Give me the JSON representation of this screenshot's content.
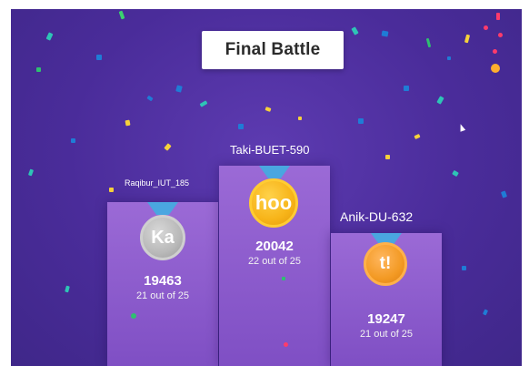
{
  "screen": {
    "title": "Final Battle",
    "background": "#4a2c9a"
  },
  "leaderboard": {
    "first": {
      "name": "Taki-BUET-590",
      "avatar": "hoo",
      "score": "20042",
      "correct": "22 out of 25",
      "medal_color": "#f7b419"
    },
    "second": {
      "name": "Raqibur_IUT_185",
      "avatar": "Ka",
      "score": "19463",
      "correct": "21 out of 25",
      "medal_color": "#b9b9b9"
    },
    "third": {
      "name": "Anik-DU-632",
      "avatar": "t!",
      "score": "19247",
      "correct": "21 out of 25",
      "medal_color": "#f39a24"
    }
  },
  "icons": {
    "cursor": "mouse-pointer-icon",
    "ribbon": "medal-ribbon-icon"
  }
}
